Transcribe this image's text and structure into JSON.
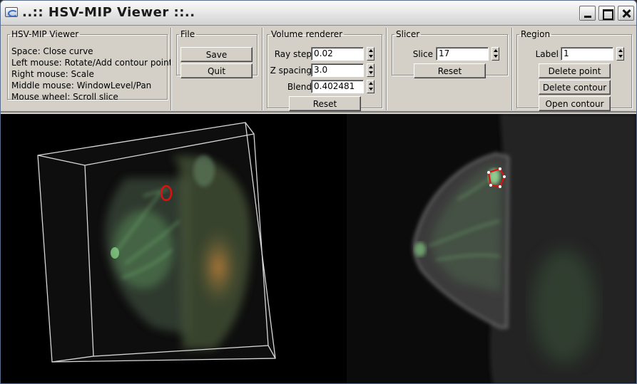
{
  "window": {
    "title": "..:: HSV-MIP Viewer ::.."
  },
  "info": {
    "legend": "HSV-MIP Viewer",
    "lines": [
      "Space: Close curve",
      "Left mouse: Rotate/Add contour point",
      "Right mouse: Scale",
      "Middle mouse: WindowLevel/Pan",
      "Mouse wheel: Scroll slice"
    ]
  },
  "file": {
    "legend": "File",
    "save_label": "Save",
    "quit_label": "Quit"
  },
  "volume": {
    "legend": "Volume renderer",
    "ray_step_label": "Ray step",
    "ray_step_value": "0.02",
    "z_spacing_label": "Z spacing",
    "z_spacing_value": "3.0",
    "blend_label": "Blend",
    "blend_value": "0.402481",
    "reset_label": "Reset"
  },
  "slicer": {
    "legend": "Slicer",
    "slice_label": "Slice",
    "slice_value": "17",
    "reset_label": "Reset"
  },
  "region": {
    "legend": "Region",
    "label_label": "Label",
    "label_value": "1",
    "delete_point_label": "Delete point",
    "delete_contour_label": "Delete contour",
    "open_contour_label": "Open contour"
  },
  "colors": {
    "viewer_background": "#000000",
    "tissue_green": "#7fc98a",
    "contour_red": "#e01010",
    "bounding_box": "#d8d8d8"
  }
}
